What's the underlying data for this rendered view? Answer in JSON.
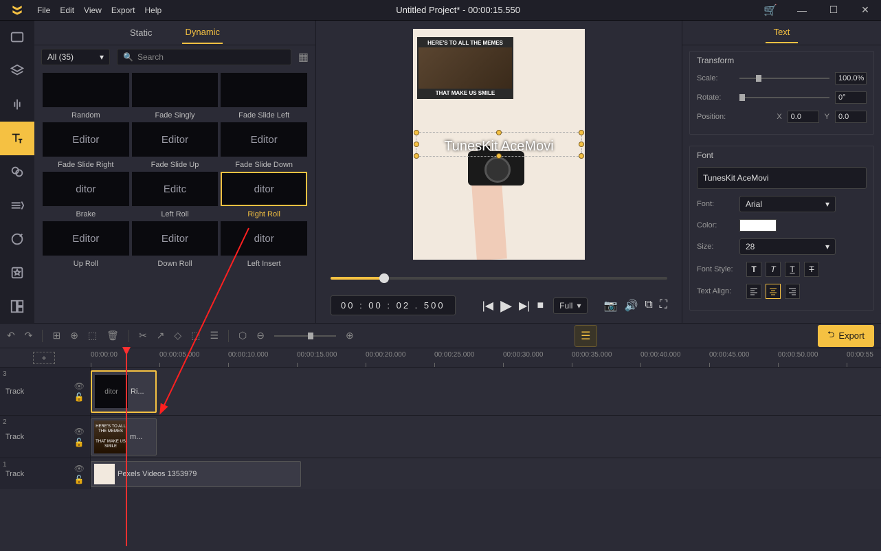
{
  "title": "Untitled Project* - 00:00:15.550",
  "menu": {
    "file": "File",
    "edit": "Edit",
    "view": "View",
    "export": "Export",
    "help": "Help"
  },
  "tabs": {
    "static": "Static",
    "dynamic": "Dynamic"
  },
  "filter": {
    "all": "All (35)",
    "search_placeholder": "Search"
  },
  "effects": [
    {
      "label": "Random",
      "thumb": ""
    },
    {
      "label": "Fade Singly",
      "thumb": ""
    },
    {
      "label": "Fade Slide Left",
      "thumb": ""
    },
    {
      "label": "Fade Slide Right",
      "thumb": "Editor"
    },
    {
      "label": "Fade Slide Up",
      "thumb": "Editor"
    },
    {
      "label": "Fade Slide Down",
      "thumb": "Editor"
    },
    {
      "label": "Brake",
      "thumb": "ditor"
    },
    {
      "label": "Left Roll",
      "thumb": "Editc"
    },
    {
      "label": "Right Roll",
      "thumb": "ditor",
      "selected": true
    },
    {
      "label": "Up Roll",
      "thumb": "Editor"
    },
    {
      "label": "Down Roll",
      "thumb": "Editor"
    },
    {
      "label": "Left Insert",
      "thumb": "ditor"
    }
  ],
  "preview": {
    "meme_top": "HERE'S TO ALL THE MEMES",
    "meme_bottom": "THAT MAKE US SMILE",
    "overlay_text": "TunesKit AceMovi",
    "timecode": "00 : 00 : 02 . 500",
    "full": "Full"
  },
  "right_panel": {
    "tab": "Text",
    "transform": {
      "title": "Transform",
      "scale_label": "Scale:",
      "scale_value": "100.0%",
      "rotate_label": "Rotate:",
      "rotate_value": "0°",
      "position_label": "Position:",
      "x_label": "X",
      "x_value": "0.0",
      "y_label": "Y",
      "y_value": "0.0"
    },
    "font": {
      "title": "Font",
      "text_value": "TunesKit AceMovi",
      "font_label": "Font:",
      "font_value": "Arial",
      "color_label": "Color:",
      "size_label": "Size:",
      "size_value": "28",
      "style_label": "Font Style:",
      "align_label": "Text Align:"
    }
  },
  "export_label": "Export",
  "ruler": [
    "00:00:00",
    "00:00:05.000",
    "00:00:10.000",
    "00:00:15.000",
    "00:00:20.000",
    "00:00:25.000",
    "00:00:30.000",
    "00:00:35.000",
    "00:00:40.000",
    "00:00:45.000",
    "00:00:50.000",
    "00:00:55"
  ],
  "tracks": {
    "t3": {
      "num": "3",
      "name": "Track",
      "clip_label": "Ri...",
      "clip_thumb": "ditor"
    },
    "t2": {
      "num": "2",
      "name": "Track",
      "clip_label": "m..."
    },
    "t1": {
      "num": "1",
      "name": "Track",
      "clip_label": "Pexels Videos 1353979"
    }
  }
}
